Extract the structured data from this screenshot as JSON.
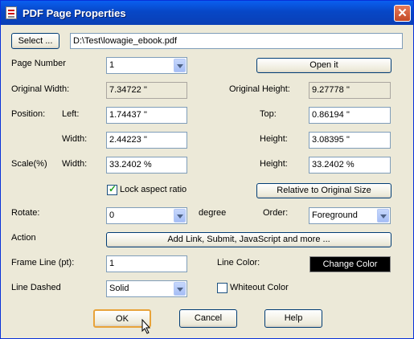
{
  "window": {
    "title": "PDF Page Properties"
  },
  "file": {
    "select_label": "Select ...",
    "path": "D:\\Test\\lowagie_ebook.pdf"
  },
  "page_number": {
    "label": "Page Number",
    "value": "1",
    "open_label": "Open it"
  },
  "original": {
    "width_label": "Original Width:",
    "width": "7.34722 ''",
    "height_label": "Original Height:",
    "height": "9.27778 ''"
  },
  "position": {
    "label": "Position:",
    "left_label": "Left:",
    "left": "1.74437 ''",
    "top_label": "Top:",
    "top": "0.86194 ''",
    "width_label": "Width:",
    "width": "2.44223 ''",
    "height_label": "Height:",
    "height": "3.08395 ''"
  },
  "scale": {
    "label": "Scale(%)",
    "width_label": "Width:",
    "width": "33.2402 %",
    "height_label": "Height:",
    "height": "33.2402 %",
    "lock_label": "Lock aspect ratio",
    "lock_checked": true,
    "relative_label": "Relative to Original Size"
  },
  "rotate": {
    "label": "Rotate:",
    "value": "0",
    "unit": "degree",
    "order_label": "Order:",
    "order_value": "Foreground"
  },
  "action": {
    "label": "Action",
    "button_label": "Add Link, Submit, JavaScript and more ..."
  },
  "frame": {
    "label": "Frame Line (pt):",
    "value": "1",
    "color_label": "Line Color:",
    "change_color_label": "Change Color"
  },
  "dashed": {
    "label": "Line Dashed",
    "value": "Solid",
    "whiteout_label": "Whiteout Color",
    "whiteout_checked": false
  },
  "footer": {
    "ok_label": "OK",
    "cancel_label": "Cancel",
    "help_label": "Help"
  },
  "colors": {
    "titlebar": "#0747c6",
    "dialog_bg": "#ece9d8",
    "change_color_bg": "#000000"
  }
}
